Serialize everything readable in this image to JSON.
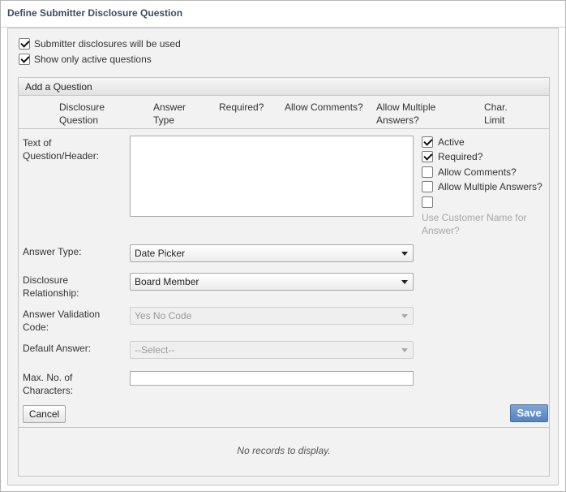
{
  "title": "Define Submitter Disclosure Question",
  "options": {
    "submitter_disclosures": {
      "label": "Submitter disclosures will be used",
      "checked": true
    },
    "show_active_only": {
      "label": "Show only active questions",
      "checked": true
    }
  },
  "section": {
    "header": "Add a Question",
    "columns": [
      {
        "label": "Disclosure\nQuestion"
      },
      {
        "label": "Answer\nType"
      },
      {
        "label": "Required?"
      },
      {
        "label": "Allow Comments?"
      },
      {
        "label": "Allow Multiple\nAnswers?"
      },
      {
        "label": "Char.\nLimit"
      }
    ]
  },
  "form": {
    "text_label": "Text of\nQuestion/Header:",
    "text_value": "",
    "answer_type_label": "Answer Type:",
    "answer_type_value": "Date Picker",
    "relationship_label": "Disclosure\nRelationship:",
    "relationship_value": "Board Member",
    "validation_label": "Answer Validation\nCode:",
    "validation_value": "Yes No Code",
    "default_label": "Default Answer:",
    "default_value": "--Select--",
    "max_chars_label": "Max. No. of\nCharacters:",
    "max_chars_value": ""
  },
  "flags": {
    "active": {
      "label": "Active",
      "checked": true
    },
    "required": {
      "label": "Required?",
      "checked": true
    },
    "allow_comments": {
      "label": "Allow Comments?",
      "checked": false
    },
    "allow_multiple": {
      "label": "Allow Multiple Answers?",
      "checked": false
    },
    "customer_name": {
      "label": "Use Customer Name for\nAnswer?",
      "checked": false
    }
  },
  "buttons": {
    "cancel": "Cancel",
    "save": "Save"
  },
  "grid": {
    "empty_message": "No records to display."
  }
}
